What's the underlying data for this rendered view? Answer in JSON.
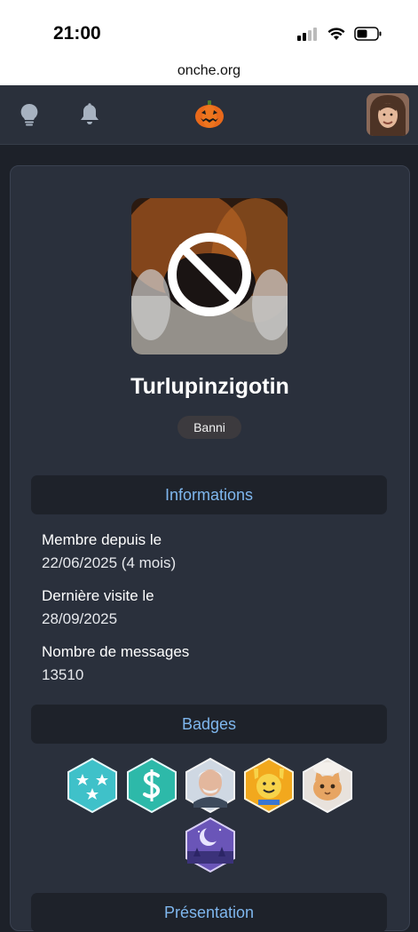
{
  "status_bar": {
    "time": "21:00"
  },
  "url_bar": {
    "domain": "onche.org"
  },
  "nav": {
    "icons": [
      "lightbulb-icon",
      "bell-icon",
      "pumpkin-logo-icon"
    ],
    "avatar": "user-avatar"
  },
  "profile": {
    "username": "Turlupinzigotin",
    "status_badge": "Banni"
  },
  "informations": {
    "title": "Informations",
    "member_since_label": "Membre depuis le",
    "member_since_value": "22/06/2025 (4 mois)",
    "last_visit_label": "Dernière visite le",
    "last_visit_value": "28/09/2025",
    "message_count_label": "Nombre de messages",
    "message_count_value": "13510"
  },
  "badges": {
    "title": "Badges",
    "items": [
      "stars-badge",
      "dollar-badge",
      "old-man-meme-badge",
      "hands-up-emoji-badge",
      "cat-badge",
      "moon-night-badge"
    ]
  },
  "presentation": {
    "title": "Présentation"
  },
  "colors": {
    "accent": "#7fb7ee",
    "page_bg": "#1d2129",
    "card_bg": "#2a303c"
  }
}
